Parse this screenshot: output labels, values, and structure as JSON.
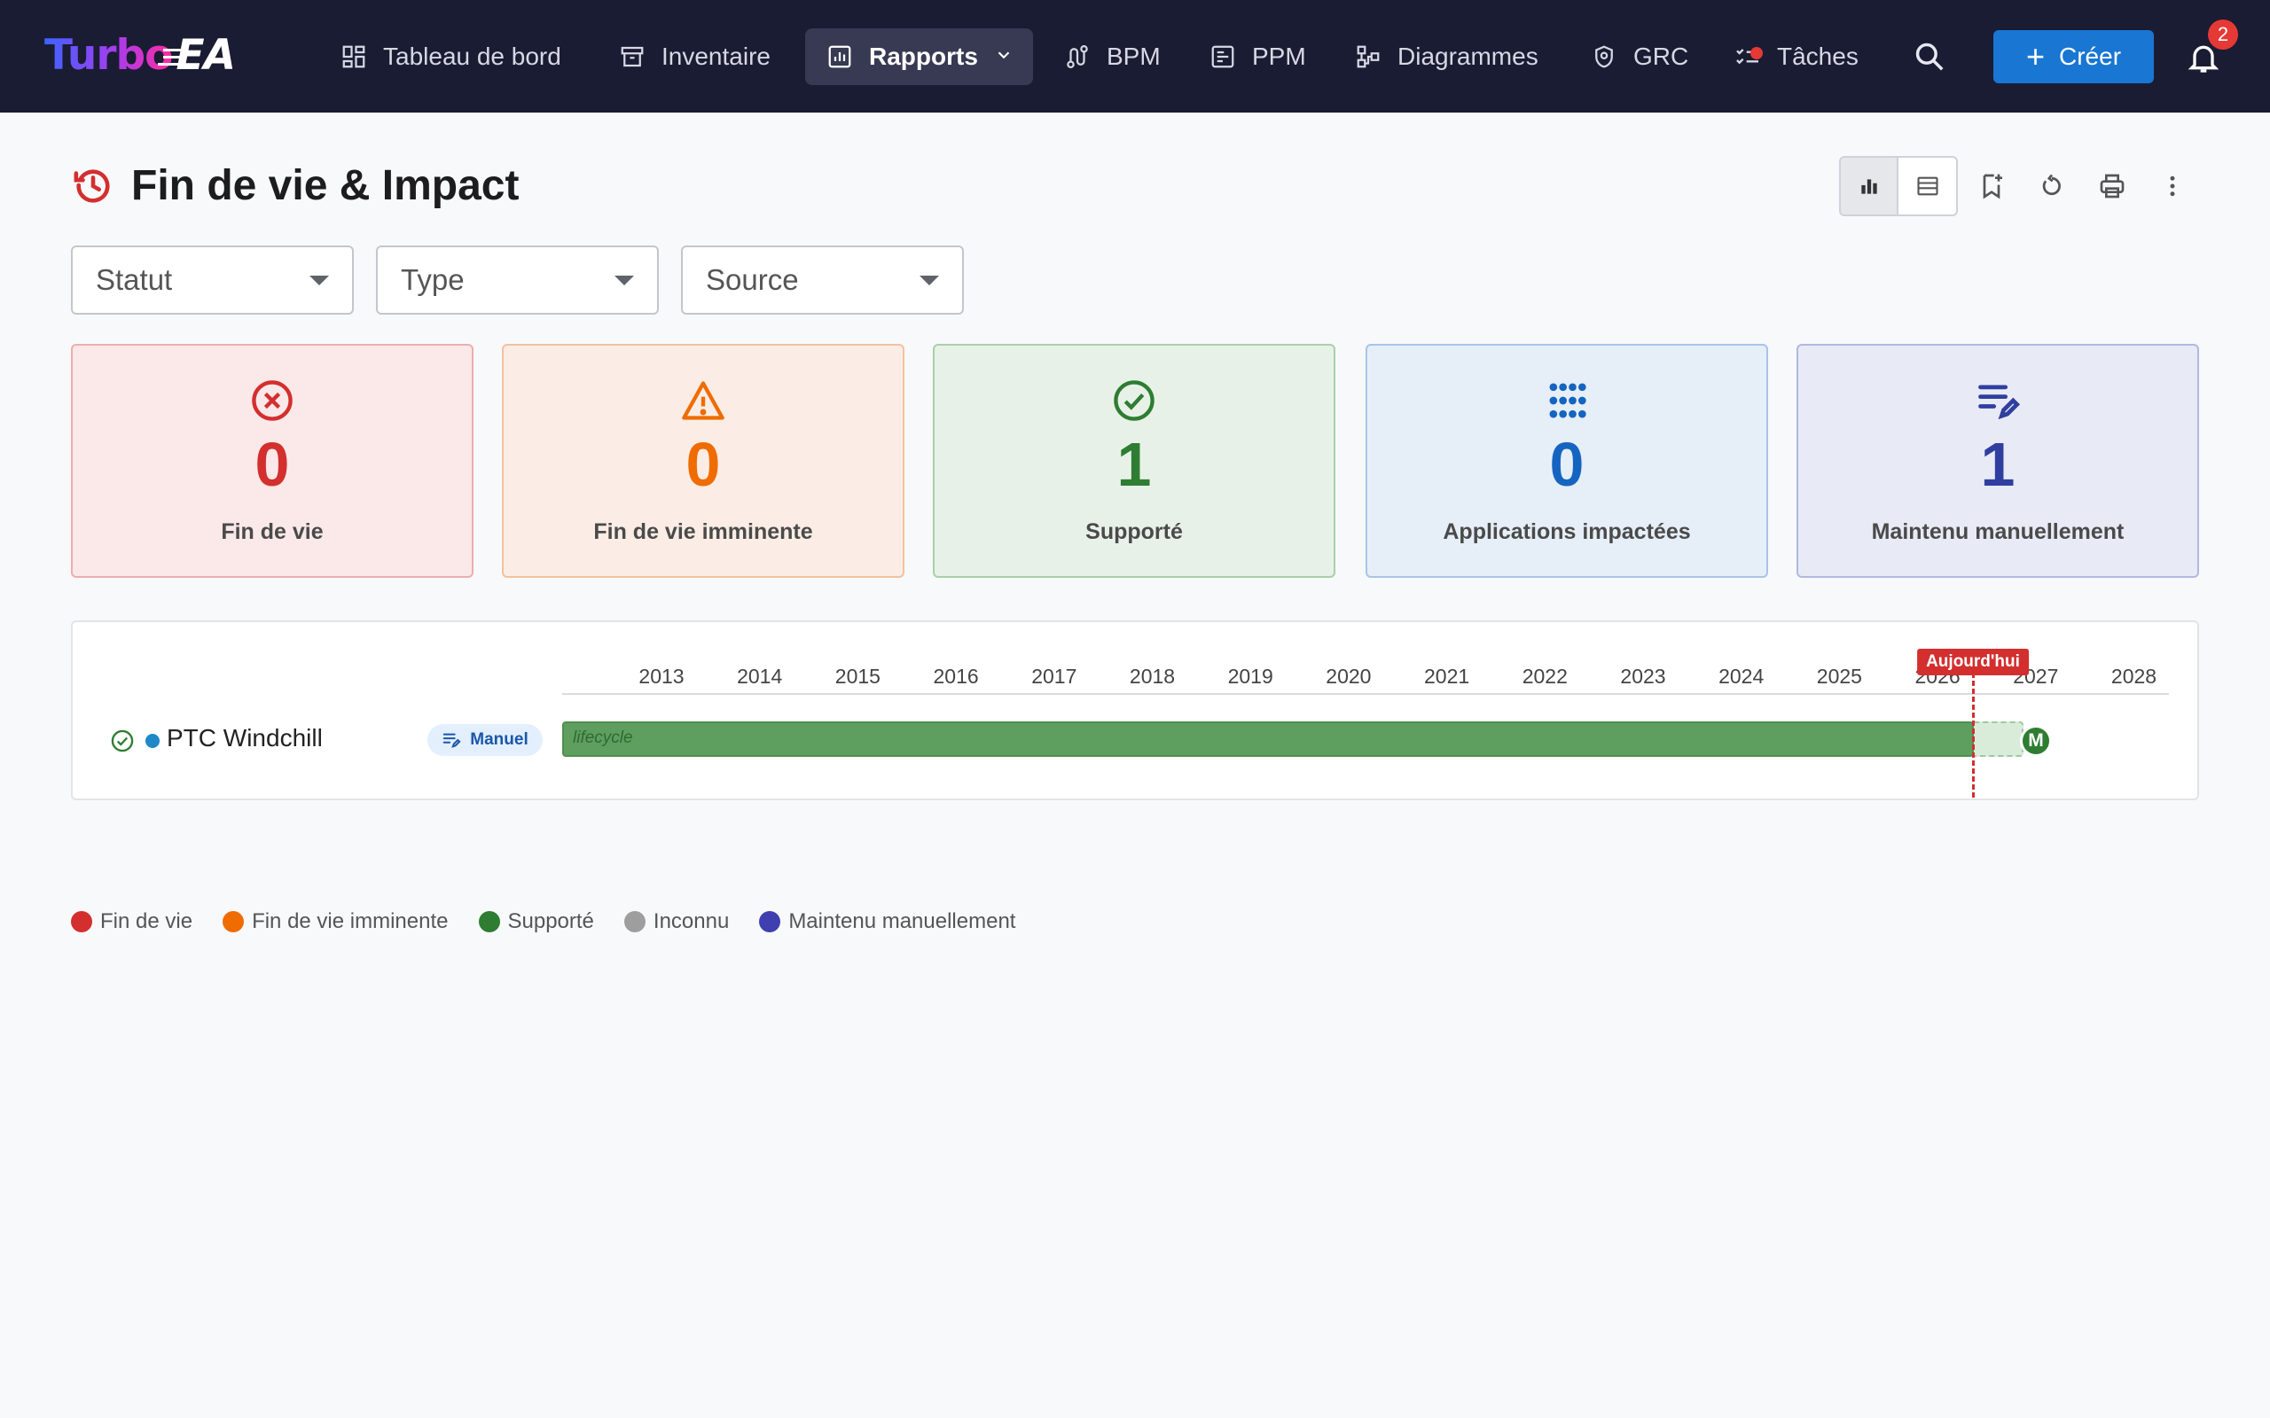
{
  "app": {
    "logo_turbo": "Turbo",
    "logo_ea": "EA"
  },
  "nav": {
    "items": [
      {
        "label": "Tableau de bord",
        "icon": "dashboard-icon"
      },
      {
        "label": "Inventaire",
        "icon": "archive-icon"
      },
      {
        "label": "Rapports",
        "icon": "report-chart-icon",
        "active": true
      },
      {
        "label": "BPM",
        "icon": "process-icon"
      },
      {
        "label": "PPM",
        "icon": "project-icon"
      },
      {
        "label": "Diagrammes",
        "icon": "diagram-icon"
      },
      {
        "label": "GRC",
        "icon": "shield-icon"
      },
      {
        "label": "Tâches",
        "icon": "tasks-icon",
        "has_indicator": true
      }
    ],
    "create_label": "Créer",
    "notification_count": "2"
  },
  "page": {
    "title": "Fin de vie & Impact",
    "title_icon": "history-alert-icon"
  },
  "toolbar": {
    "view_modes": [
      "chart-view-icon",
      "table-view-icon"
    ],
    "active_view": "chart",
    "actions": [
      "bookmark-add-icon",
      "reset-icon",
      "print-icon",
      "more-vert-icon"
    ]
  },
  "filters": [
    {
      "label": "Statut"
    },
    {
      "label": "Type"
    },
    {
      "label": "Source"
    }
  ],
  "kpis": [
    {
      "value": "0",
      "label": "Fin de vie",
      "icon": "cancel-circle-icon",
      "color": "#d32f2f",
      "bg": "#fbe8e8",
      "border": "#ecaeae"
    },
    {
      "value": "0",
      "label": "Fin de vie imminente",
      "icon": "warning-icon",
      "color": "#ef6c00",
      "bg": "#fbede5",
      "border": "#f3c19e"
    },
    {
      "value": "1",
      "label": "Supporté",
      "icon": "check-circle-icon",
      "color": "#2e7d32",
      "bg": "#e8f1e8",
      "border": "#a9cfaa"
    },
    {
      "value": "0",
      "label": "Applications impactées",
      "icon": "apps-grid-icon",
      "color": "#1565c0",
      "bg": "#e6eef8",
      "border": "#a8c4e8"
    },
    {
      "value": "1",
      "label": "Maintenu manuellement",
      "icon": "edit-note-icon",
      "color": "#303f9f",
      "bg": "#e8eaf5",
      "border": "#b2b8e0"
    }
  ],
  "timeline": {
    "years": [
      "2013",
      "2014",
      "2015",
      "2016",
      "2017",
      "2018",
      "2019",
      "2020",
      "2021",
      "2022",
      "2023",
      "2024",
      "2025",
      "2026",
      "2027",
      "2028"
    ],
    "today_label": "Aujourd'hui",
    "rows": [
      {
        "name": "PTC Windchill",
        "status_icon": "check-circle-outline-icon",
        "dot_color": "#1e88c8",
        "chip_label": "Manuel",
        "chip_icon": "edit-note-icon",
        "bar_label": "lifecycle",
        "milestone_label": "M"
      }
    ]
  },
  "legend": [
    {
      "label": "Fin de vie",
      "color": "#d32f2f"
    },
    {
      "label": "Fin de vie imminente",
      "color": "#ef6c00"
    },
    {
      "label": "Supporté",
      "color": "#2e7d32"
    },
    {
      "label": "Inconnu",
      "color": "#9e9e9e"
    },
    {
      "label": "Maintenu manuellement",
      "color": "#3f3fb0"
    }
  ]
}
